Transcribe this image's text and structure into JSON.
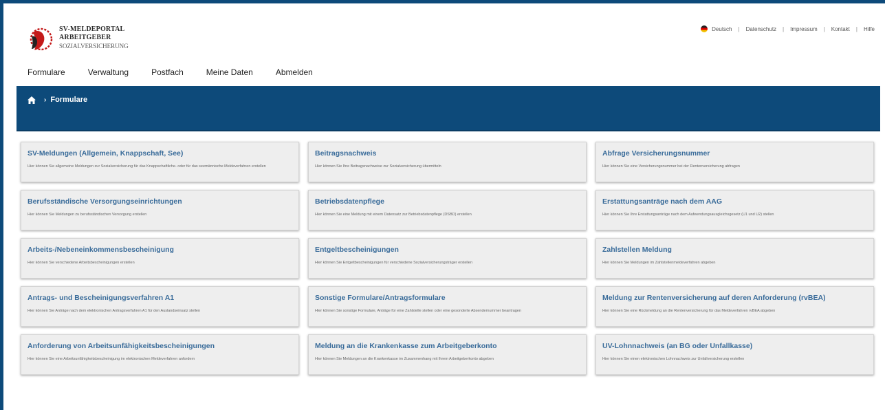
{
  "header": {
    "logo": {
      "line1": "SV-MELDEPORTAL",
      "line2": "ARBEITGEBER",
      "line3": "SOZIALVERSICHERUNG"
    },
    "topbar": {
      "language": "Deutsch",
      "links": [
        "Datenschutz",
        "Impressum",
        "Kontakt",
        "Hilfe"
      ]
    }
  },
  "nav": {
    "items": [
      "Formulare",
      "Verwaltung",
      "Postfach",
      "Meine Daten",
      "Abmelden"
    ]
  },
  "breadcrumb": {
    "current": "Formulare"
  },
  "cards": [
    {
      "title": "SV-Meldungen (Allgemein, Knappschaft, See)",
      "desc": "Hier können Sie allgemeine Meldungen zur Sozialversicherung für das Knappschaftliche- oder für das seemännische Meldeverfahren erstellen"
    },
    {
      "title": "Beitragsnachweis",
      "desc": "Hier können Sie Ihre Beitragsnachweise zur Sozialversicherung übermitteln"
    },
    {
      "title": "Abfrage Versicherungsnummer",
      "desc": "Hier können Sie eine Versicherungsnummer bei der Rentenversicherung abfragen"
    },
    {
      "title": "Berufsständische Versorgungseinrichtungen",
      "desc": "Hier können Sie Meldungen zu berufsständischen Versorgung erstellen"
    },
    {
      "title": "Betriebsdatenpflege",
      "desc": "Hier können Sie eine Meldung mit einem Datensatz zur Betriebsdatenpflege (DSBD) erstellen"
    },
    {
      "title": "Erstattungsanträge nach dem AAG",
      "desc": "Hier können Sie Ihre Erstattungsanträge nach dem Aufwendungsausgleichsgesetz (U1 und U2) stellen"
    },
    {
      "title": "Arbeits-/Nebeneinkommensbescheinigung",
      "desc": "Hier können Sie verschiedene Arbeitsbescheinigungen erstellen"
    },
    {
      "title": "Entgeltbescheinigungen",
      "desc": "Hier können Sie Entgeltbescheinigungen für verschiedene Sozialversicherungsträger erstellen"
    },
    {
      "title": "Zahlstellen Meldung",
      "desc": "Hier können Sie Meldungen im Zahlstellenmeldeverfahren abgeben"
    },
    {
      "title": "Antrags- und Bescheinigungsverfahren A1",
      "desc": "Hier können Sie Anträge nach dem elektronischen Antragsverfahren A1 für den Auslandseinsatz stellen"
    },
    {
      "title": "Sonstige Formulare/Antragsformulare",
      "desc": "Hier können Sie sonstige Formulare, Anträge für eine Zahlstelle stellen oder eine gesonderte Absendernummer beantragen"
    },
    {
      "title": "Meldung zur Rentenversicherung auf deren Anforderung (rvBEA)",
      "desc": "Hier können Sie eine Rückmeldung an die Rentenversicherung für das Meldeverfahren rvBEA abgeben"
    },
    {
      "title": "Anforderung von Arbeitsunfähigkeitsbescheinigungen",
      "desc": "Hier können Sie eine Arbeitsunfähigkeitsbescheinigung im elektronischen Meldeverfahren anfordern"
    },
    {
      "title": "Meldung an die Krankenkasse zum Arbeitgeberkonto",
      "desc": "Hier können Sie Meldungen an die Krankenkasse im Zusammenhang mit Ihrem Arbeitgeberkonto abgeben"
    },
    {
      "title": "UV-Lohnnachweis (an BG oder Unfallkasse)",
      "desc": "Hier können Sie einen elektronischen Lohnnachweis zur Unfallversicherung erstellen"
    }
  ],
  "colors": {
    "brand_blue": "#0d4a7a",
    "card_title": "#3a6c9a",
    "card_bg": "#eeeeee"
  }
}
